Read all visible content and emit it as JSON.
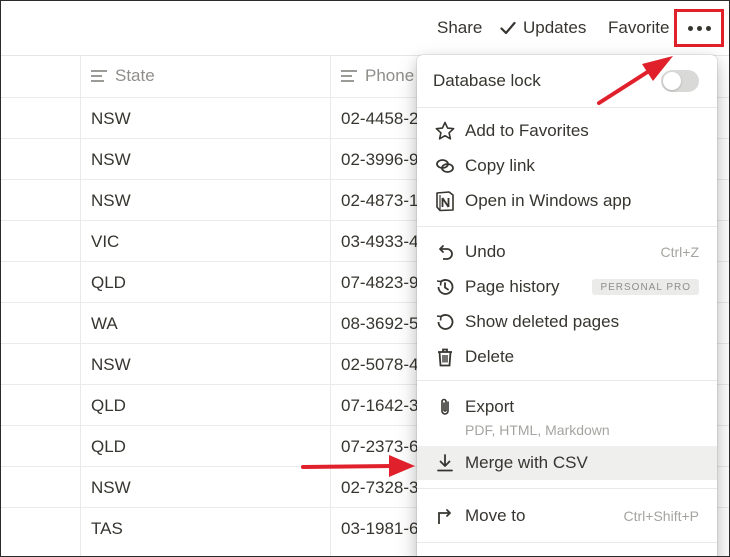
{
  "topbar": {
    "share": "Share",
    "updates": "Updates",
    "favorite": "Favorite",
    "more_icon": "more-horizontal-icon"
  },
  "table": {
    "columns": [
      {
        "label": "State",
        "icon": "text-property-icon"
      },
      {
        "label": "Phone",
        "icon": "text-property-icon"
      }
    ],
    "rows": [
      {
        "state": "NSW",
        "phone": "02-4458-2"
      },
      {
        "state": "NSW",
        "phone": "02-3996-9"
      },
      {
        "state": "NSW",
        "phone": "02-4873-1"
      },
      {
        "state": "VIC",
        "phone": "03-4933-4"
      },
      {
        "state": "QLD",
        "phone": "07-4823-9"
      },
      {
        "state": "WA",
        "phone": "08-3692-5"
      },
      {
        "state": "NSW",
        "phone": "02-5078-4"
      },
      {
        "state": "QLD",
        "phone": "07-1642-3"
      },
      {
        "state": "QLD",
        "phone": "07-2373-6"
      },
      {
        "state": "NSW",
        "phone": "02-7328-3"
      },
      {
        "state": "TAS",
        "phone": "03-1981-6"
      }
    ]
  },
  "menu": {
    "database_lock": {
      "label": "Database lock",
      "enabled": false
    },
    "add_favorites": {
      "label": "Add to Favorites",
      "icon": "star-icon"
    },
    "copy_link": {
      "label": "Copy link",
      "icon": "link-icon"
    },
    "open_app": {
      "label": "Open in Windows app",
      "icon": "notion-logo-icon"
    },
    "undo": {
      "label": "Undo",
      "shortcut": "Ctrl+Z",
      "icon": "undo-icon"
    },
    "page_history": {
      "label": "Page history",
      "badge": "PERSONAL PRO",
      "icon": "history-icon"
    },
    "show_deleted": {
      "label": "Show deleted pages",
      "icon": "restore-icon"
    },
    "delete": {
      "label": "Delete",
      "icon": "trash-icon"
    },
    "export": {
      "label": "Export",
      "sub": "PDF, HTML, Markdown",
      "icon": "paperclip-icon"
    },
    "merge_csv": {
      "label": "Merge with CSV",
      "icon": "download-icon"
    },
    "move_to": {
      "label": "Move to",
      "shortcut": "Ctrl+Shift+P",
      "icon": "move-to-icon"
    }
  },
  "colors": {
    "annotation": "#e0202a",
    "text": "#37352f",
    "muted": "#a5a4a0",
    "highlight": "#efefee"
  }
}
